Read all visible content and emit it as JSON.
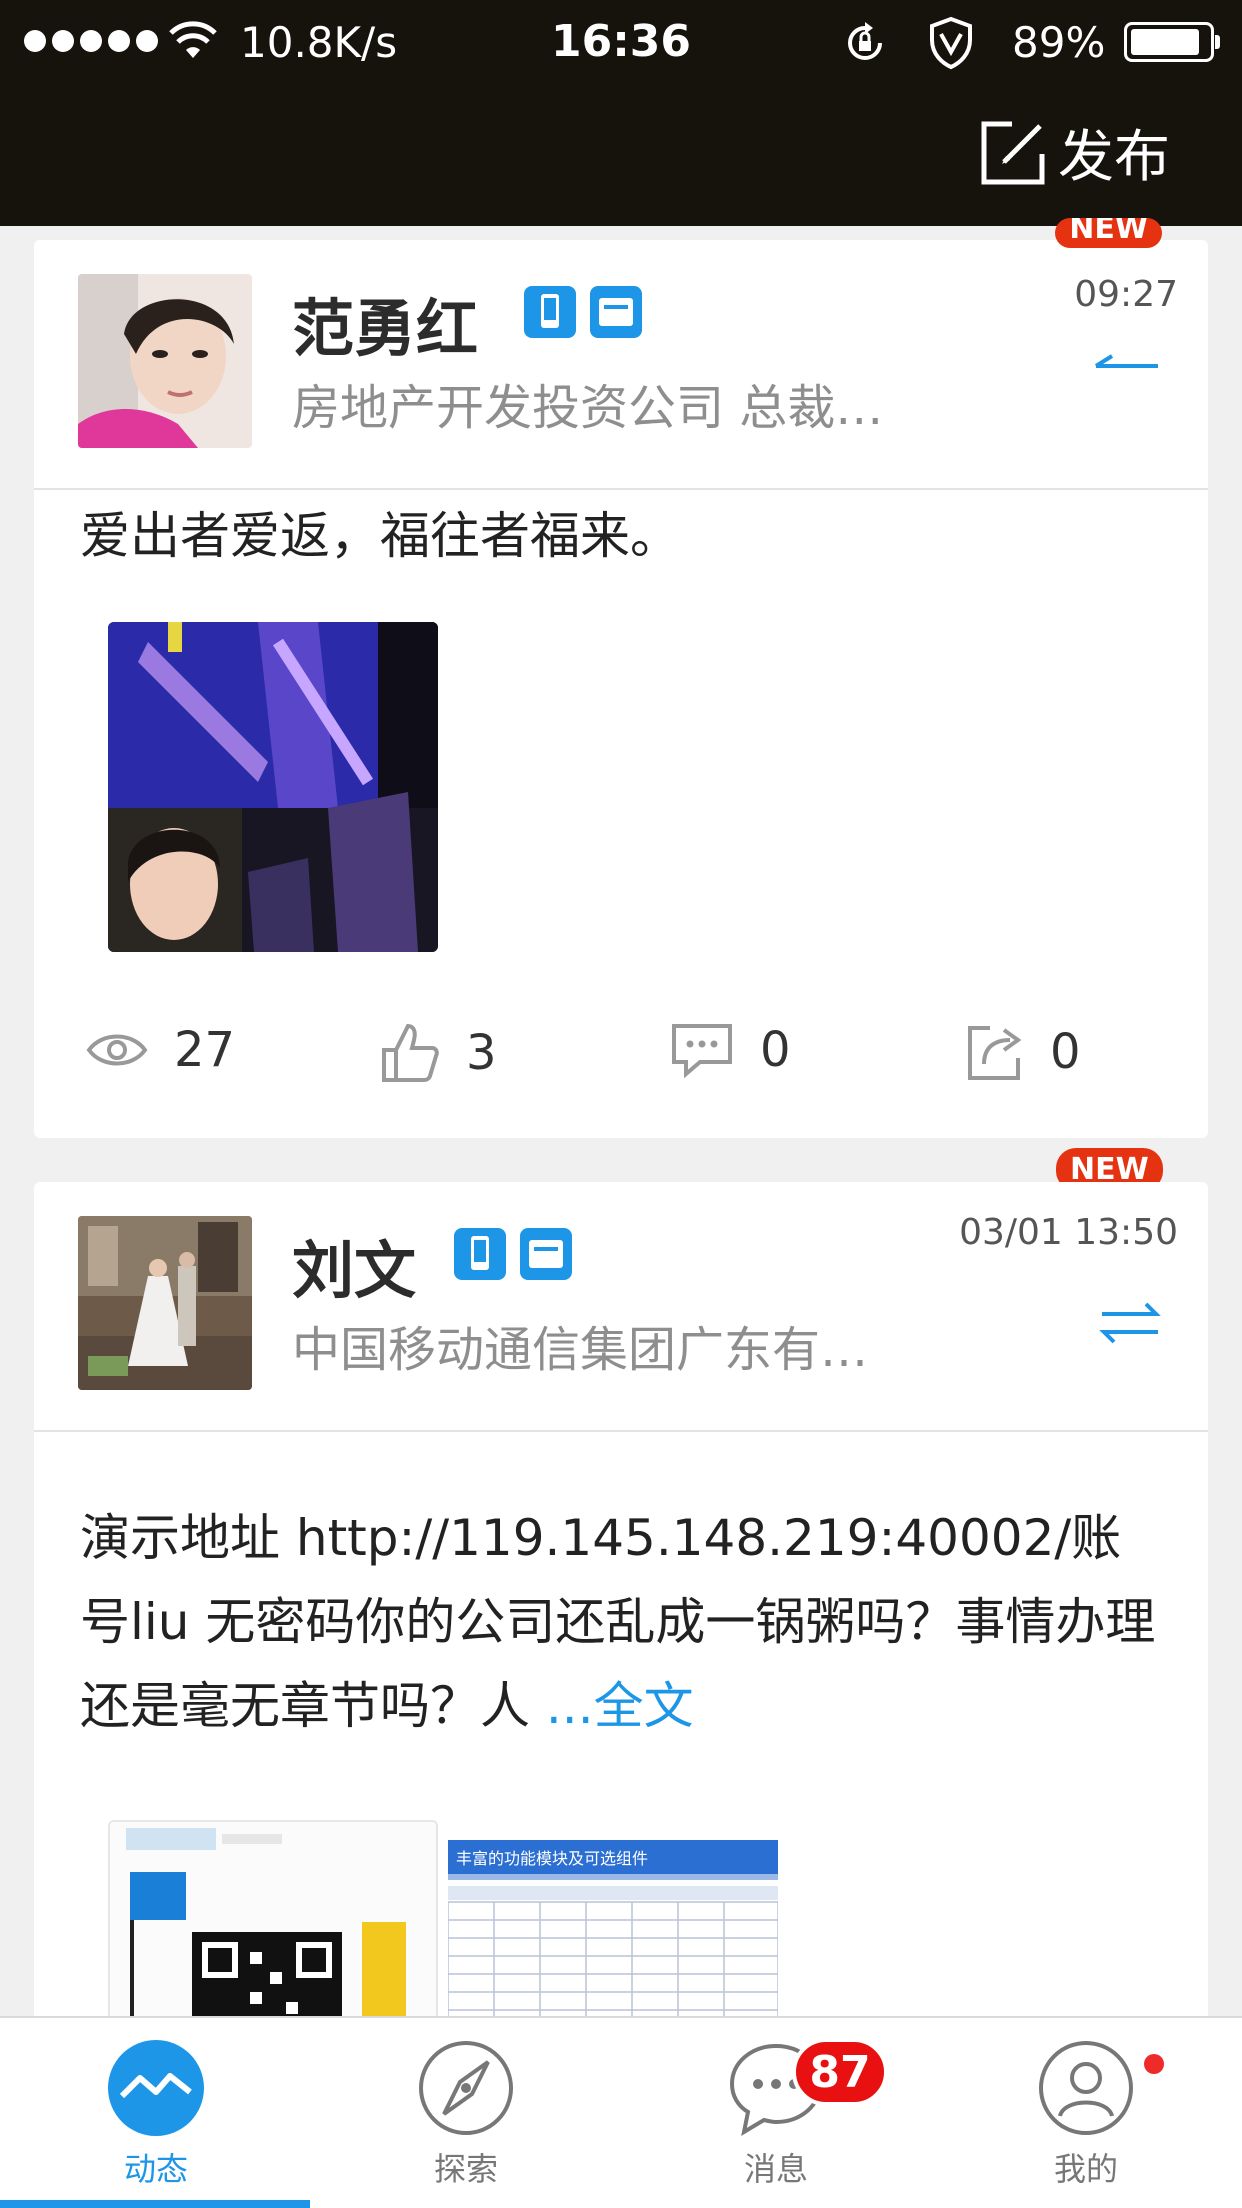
{
  "status_bar": {
    "net_speed": "10.8K/s",
    "time": "16:36",
    "battery_percent": "89%",
    "battery_level": 0.89
  },
  "header": {
    "publish_label": "发布",
    "publish_icon": "edit-icon"
  },
  "posts": [
    {
      "name": "范勇红",
      "company": "房地产开发投资公司  总裁…",
      "time": "09:27",
      "new_label": "NEW",
      "text": "爱出者爱返，福往者福来。",
      "views": "27",
      "likes": "3",
      "comments": "0",
      "shares": "0"
    },
    {
      "name": "刘文",
      "company": "中国移动通信集团广东有…",
      "time": "03/01 13:50",
      "new_label": "NEW",
      "text": "演示地址 http://119.145.148.219:40002/账号liu 无密码你的公司还乱成一锅粥吗？事情办理还是毫无章节吗？人  ",
      "more_label": "...全文",
      "thumb2_title": "丰富的功能模块及可选组件"
    }
  ],
  "tabbar": {
    "tabs": [
      {
        "label": "动态",
        "icon": "activity-icon",
        "active": true
      },
      {
        "label": "探索",
        "icon": "compass-icon"
      },
      {
        "label": "消息",
        "icon": "message-icon",
        "badge": "87"
      },
      {
        "label": "我的",
        "icon": "profile-icon"
      }
    ]
  },
  "colors": {
    "accent": "#1e96e8",
    "header_bg": "#16120c",
    "new_badge": "#e53312",
    "count_badge": "#e81010"
  }
}
